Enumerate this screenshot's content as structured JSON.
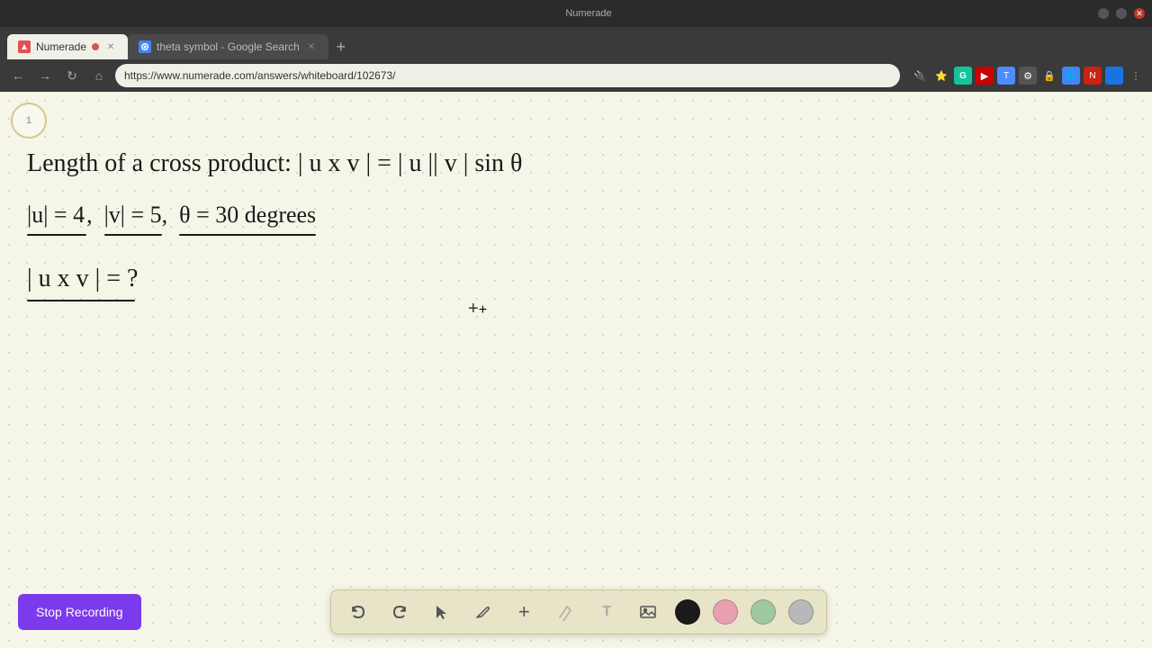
{
  "browser": {
    "tabs": [
      {
        "id": "numerade",
        "label": "Numerade",
        "favicon_color": "#e05050",
        "active": true,
        "has_dot": true
      },
      {
        "id": "google",
        "label": "theta symbol - Google Search",
        "favicon_color": "#4285f4",
        "active": false,
        "has_dot": false
      }
    ],
    "url": "https://www.numerade.com/answers/whiteboard/102673/",
    "new_tab_label": "+",
    "nav": {
      "back": "←",
      "forward": "→",
      "refresh": "↻",
      "home": "⌂"
    }
  },
  "whiteboard": {
    "line1": "Length of a cross product: | u x v | = | u || v | sin θ",
    "line2_text": "|u| = 4, |v| = 5, θ = 30 degrees",
    "line3_text": "| u x v | = ?",
    "badge_label": "1"
  },
  "toolbar": {
    "undo_label": "↺",
    "redo_label": "↻",
    "select_label": "▷",
    "pen_label": "✏",
    "plus_label": "+",
    "eraser_label": "/",
    "text_label": "T",
    "image_label": "🖼",
    "colors": [
      "black",
      "pink",
      "green",
      "gray"
    ]
  },
  "stop_recording_button": {
    "label": "Stop Recording"
  }
}
